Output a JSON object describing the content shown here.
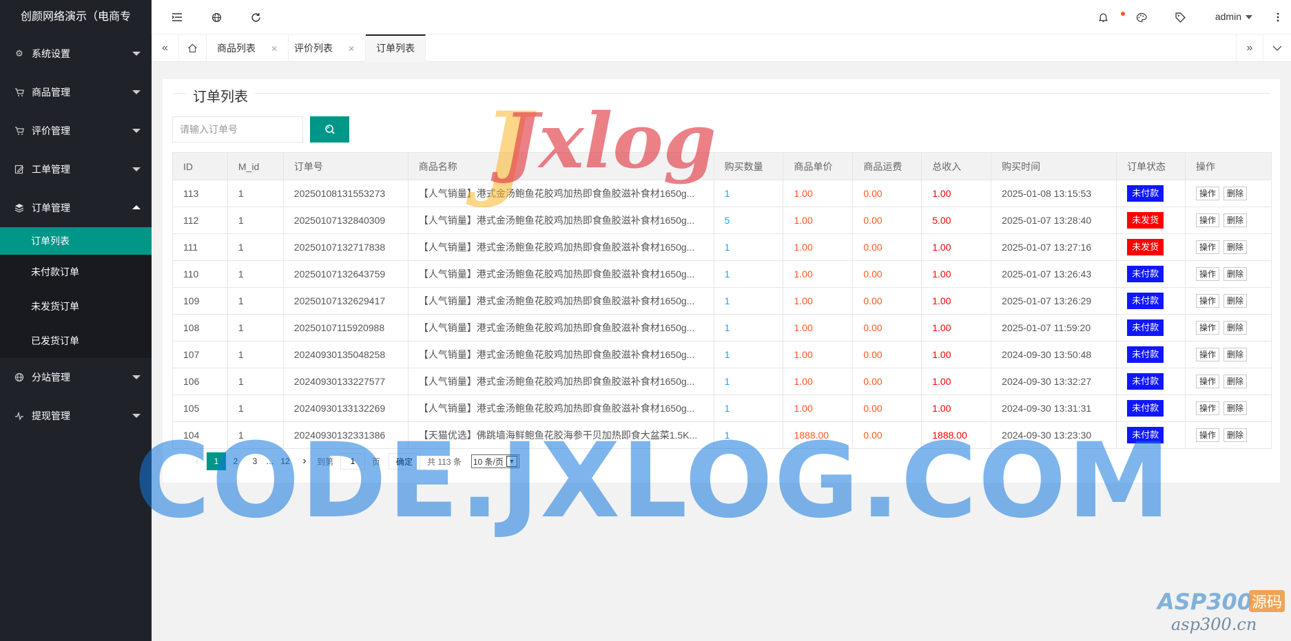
{
  "app": {
    "title": "创颜网络演示（电商专"
  },
  "sidebar": {
    "items": [
      {
        "label": "系统设置",
        "icon": "gear-icon"
      },
      {
        "label": "商品管理",
        "icon": "cart-icon"
      },
      {
        "label": "评价管理",
        "icon": "cart-icon"
      },
      {
        "label": "工单管理",
        "icon": "edit-icon"
      },
      {
        "label": "订单管理",
        "icon": "layers-icon"
      },
      {
        "label": "分站管理",
        "icon": "globe-icon"
      },
      {
        "label": "提现管理",
        "icon": "chart-icon"
      }
    ],
    "order_sub": [
      "订单列表",
      "未付款订单",
      "未发货订单",
      "已发货订单"
    ]
  },
  "header": {
    "user": "admin"
  },
  "tabs": [
    {
      "label": "商品列表"
    },
    {
      "label": "评价列表"
    },
    {
      "label": "订单列表"
    }
  ],
  "page": {
    "title": "订单列表",
    "search_placeholder": "请输入订单号"
  },
  "table": {
    "headers": [
      "ID",
      "M_id",
      "订单号",
      "商品名称",
      "购买数量",
      "商品单价",
      "商品运费",
      "总收入",
      "购买时间",
      "订单状态",
      "操作"
    ],
    "action_labels": [
      "操作",
      "删除"
    ],
    "rows": [
      [
        "113",
        "1",
        "20250108131553273",
        "【人气销量】港式金汤鲍鱼花胶鸡加热即食鱼胶滋补食材1650g...",
        "1",
        "1.00",
        "0.00",
        "1.00",
        "2025-01-08 13:15:53",
        "未付款"
      ],
      [
        "112",
        "1",
        "20250107132840309",
        "【人气销量】港式金汤鲍鱼花胶鸡加热即食鱼胶滋补食材1650g...",
        "5",
        "1.00",
        "0.00",
        "5.00",
        "2025-01-07 13:28:40",
        "未发货"
      ],
      [
        "111",
        "1",
        "20250107132717838",
        "【人气销量】港式金汤鲍鱼花胶鸡加热即食鱼胶滋补食材1650g...",
        "1",
        "1.00",
        "0.00",
        "1.00",
        "2025-01-07 13:27:16",
        "未发货"
      ],
      [
        "110",
        "1",
        "20250107132643759",
        "【人气销量】港式金汤鲍鱼花胶鸡加热即食鱼胶滋补食材1650g...",
        "1",
        "1.00",
        "0.00",
        "1.00",
        "2025-01-07 13:26:43",
        "未付款"
      ],
      [
        "109",
        "1",
        "20250107132629417",
        "【人气销量】港式金汤鲍鱼花胶鸡加热即食鱼胶滋补食材1650g...",
        "1",
        "1.00",
        "0.00",
        "1.00",
        "2025-01-07 13:26:29",
        "未付款"
      ],
      [
        "108",
        "1",
        "20250107115920988",
        "【人气销量】港式金汤鲍鱼花胶鸡加热即食鱼胶滋补食材1650g...",
        "1",
        "1.00",
        "0.00",
        "1.00",
        "2025-01-07 11:59:20",
        "未付款"
      ],
      [
        "107",
        "1",
        "20240930135048258",
        "【人气销量】港式金汤鲍鱼花胶鸡加热即食鱼胶滋补食材1650g...",
        "1",
        "1.00",
        "0.00",
        "1.00",
        "2024-09-30 13:50:48",
        "未付款"
      ],
      [
        "106",
        "1",
        "20240930133227577",
        "【人气销量】港式金汤鲍鱼花胶鸡加热即食鱼胶滋补食材1650g...",
        "1",
        "1.00",
        "0.00",
        "1.00",
        "2024-09-30 13:32:27",
        "未付款"
      ],
      [
        "105",
        "1",
        "20240930133132269",
        "【人气销量】港式金汤鲍鱼花胶鸡加热即食鱼胶滋补食材1650g...",
        "1",
        "1.00",
        "0.00",
        "1.00",
        "2024-09-30 13:31:31",
        "未付款"
      ],
      [
        "104",
        "1",
        "20240930132331386",
        "【天猫优选】佛跳墙海鲜鲍鱼花胶海参干贝加热即食大盆菜1.5K...",
        "1",
        "1888.00",
        "0.00",
        "1888.00",
        "2024-09-30 13:23:30",
        "未付款"
      ]
    ]
  },
  "pager": {
    "pages": [
      "1",
      "2",
      "3",
      "…",
      "12"
    ],
    "goto_prefix": "到第",
    "goto_value": "1",
    "goto_suffix": "页",
    "confirm": "确定",
    "total": "共 113 条",
    "limit": "10 条/页"
  },
  "watermarks": {
    "big": "CODE.JXLOG.COM",
    "logo": "Jxlog",
    "asp": "ASP300",
    "asp_domain": "asp300.cn",
    "src": "源码"
  },
  "colors": {
    "accent": "#009688",
    "sidebar": "#20222a",
    "unpaid": "#1017ff",
    "unshipped": "#ff0000"
  }
}
